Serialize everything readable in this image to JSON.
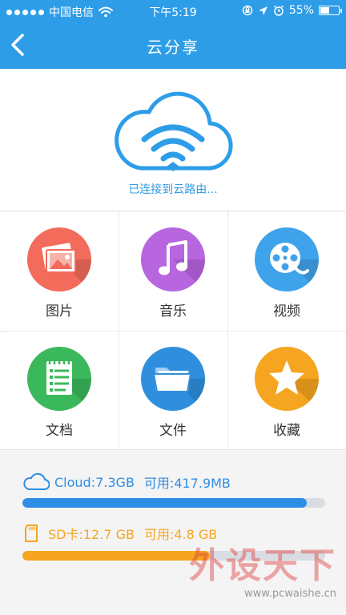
{
  "status_bar": {
    "carrier": "中国电信",
    "time": "下午5:19",
    "battery": "55%",
    "battery_level": 0.55,
    "icons": [
      "signal-dots-icon",
      "wifi-icon",
      "lock-rotation-icon",
      "location-arrow-icon",
      "alarm-icon",
      "battery-icon"
    ]
  },
  "nav": {
    "title": "云分享",
    "back_icon": "chevron-left-icon"
  },
  "hero": {
    "icon": "cloud-wifi-icon",
    "status_text": "已连接到云路由..."
  },
  "categories": [
    {
      "label": "图片",
      "icon": "pictures-icon",
      "color": "#f26b5b"
    },
    {
      "label": "音乐",
      "icon": "music-note-icon",
      "color": "#b865e0"
    },
    {
      "label": "视频",
      "icon": "film-reel-icon",
      "color": "#3fa3ec"
    },
    {
      "label": "文档",
      "icon": "notepad-icon",
      "color": "#3cb85c"
    },
    {
      "label": "文件",
      "icon": "folder-icon",
      "color": "#2f8fde"
    },
    {
      "label": "收藏",
      "icon": "star-icon",
      "color": "#f5a51f"
    }
  ],
  "storage": {
    "cloud": {
      "icon": "cloud-outline-icon",
      "total_text": "Cloud:7.3GB",
      "free_text": "可用:417.9MB",
      "used_fraction": 0.94,
      "color": "#2e8ee6"
    },
    "sd": {
      "icon": "sd-card-icon",
      "total_text": "SD卡:12.7 GB",
      "free_text": "可用:4.8 GB",
      "used_fraction": 0.62,
      "color": "#f5a51f"
    }
  },
  "watermark": {
    "brand": "外设天下",
    "url": "www.pcwaishe.cn"
  }
}
